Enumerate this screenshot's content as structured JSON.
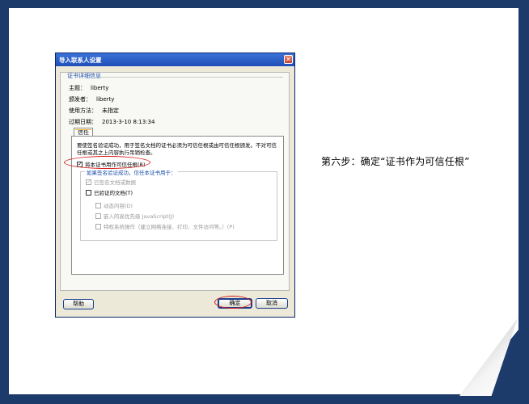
{
  "caption": "第六步：确定“证书作为可信任根”",
  "dialog": {
    "title": "导入联系人设置",
    "section_title": "证书详细信息",
    "fields": [
      {
        "label": "主题：",
        "value": "liberty"
      },
      {
        "label": "颁发者：",
        "value": "liberty"
      },
      {
        "label": "使用方法：",
        "value": "未指定"
      },
      {
        "label": "过期日期：",
        "value": "2013-3-10 8:13:34"
      }
    ],
    "tab_label": "信任",
    "description": "要使签名验证成功，用于签名文档的证书必须为可信任根或由可信任根颁发。不对可信任根或其之上内容执行吊销检查。",
    "trust_root_checkbox": "将本证书用作可信任根(R)",
    "group_title": "如果签名验证成功，信任本证书用于：",
    "options": {
      "signed_docs": "已签名文档或数据",
      "certified_docs": "已验证的文档(T)",
      "dynamic": "动态内容(D)",
      "javascript": "嵌入的高优先级 JavaScript(J)",
      "privileged": "特权系统操作（建立网络连接、打印、文件访问等。）(P)"
    },
    "buttons": {
      "help": "帮助",
      "ok": "确定",
      "cancel": "取消"
    }
  }
}
